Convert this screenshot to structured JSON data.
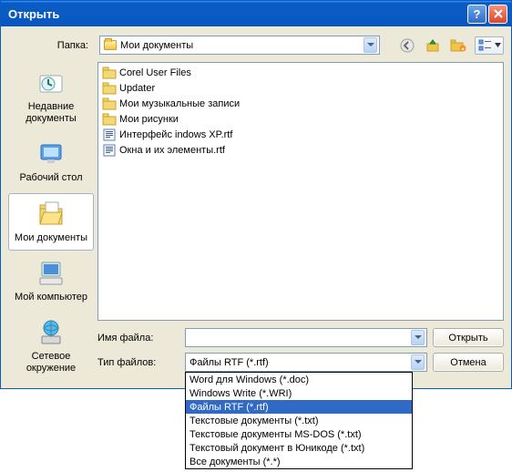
{
  "titlebar": {
    "title": "Открыть"
  },
  "toprow": {
    "label": "Папка:",
    "combo_value": "Мои документы"
  },
  "places": {
    "items": [
      {
        "label": "Недавние документы"
      },
      {
        "label": "Рабочий стол"
      },
      {
        "label": "Мои документы"
      },
      {
        "label": "Мой компьютер"
      },
      {
        "label": "Сетевое окружение"
      }
    ]
  },
  "files": [
    {
      "type": "folder",
      "name": "Corel User Files"
    },
    {
      "type": "folder",
      "name": "Updater"
    },
    {
      "type": "folder",
      "name": "Мои музыкальные записи"
    },
    {
      "type": "folder",
      "name": "Мои рисунки"
    },
    {
      "type": "rtf",
      "name": "Интерфейс indows XP.rtf"
    },
    {
      "type": "rtf",
      "name": "Окна и их элементы.rtf"
    }
  ],
  "bottom": {
    "filename_label": "Имя файла:",
    "filename_value": "",
    "filetype_label": "Тип файлов:",
    "filetype_value": "Файлы RTF (*.rtf)",
    "open_button": "Открыть",
    "cancel_button": "Отмена"
  },
  "dropdown": {
    "options": [
      "Word для Windows (*.doc)",
      "Windows Write (*.WRI)",
      "Файлы RTF (*.rtf)",
      "Текстовые документы (*.txt)",
      "Текстовые документы MS-DOS (*.txt)",
      "Текстовый документ в Юникоде (*.txt)",
      "Все документы (*.*)"
    ],
    "selected_index": 2
  }
}
